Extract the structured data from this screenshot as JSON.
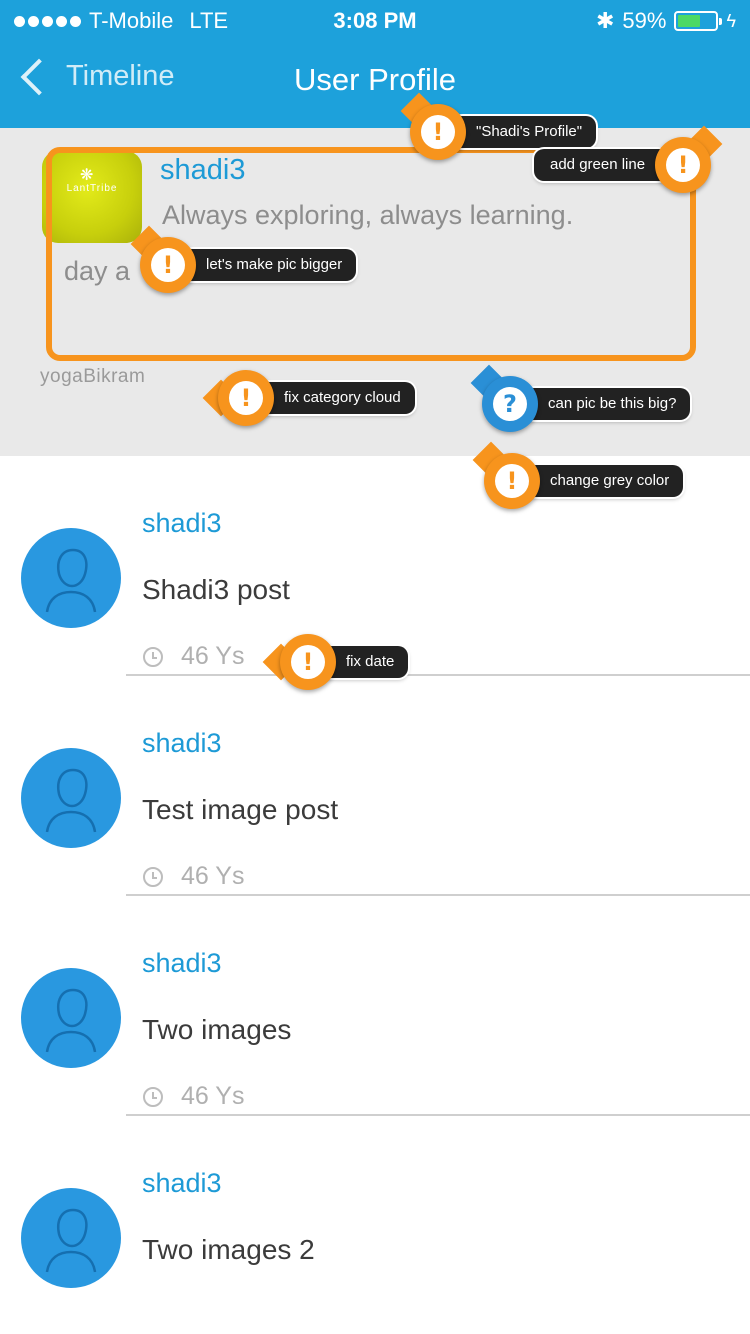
{
  "status_bar": {
    "carrier": "T-Mobile",
    "network": "LTE",
    "time": "3:08 PM",
    "battery_percent": "59%",
    "battery_level": 0.59,
    "colors": {
      "battery_fill": "#4cd964"
    }
  },
  "nav": {
    "back_label": "Timeline",
    "title": "User Profile",
    "colors": {
      "background": "#1da1db"
    }
  },
  "profile": {
    "username": "shadi3",
    "bio": "Always exploring, always learning.",
    "bio_overflow": "day a",
    "category": "yogaBikram",
    "avatar_icon": "lanttribe-logo",
    "avatar_text": "LantTribe",
    "colors": {
      "background": "#e9e9e9",
      "username": "#1d9ad6"
    }
  },
  "posts": [
    {
      "user": "shadi3",
      "text": "Shadi3 post",
      "date": "46 Ys"
    },
    {
      "user": "shadi3",
      "text": "Test image post",
      "date": "46 Ys"
    },
    {
      "user": "shadi3",
      "text": "Two images",
      "date": "46 Ys"
    },
    {
      "user": "shadi3",
      "text": "Two images 2",
      "date": ""
    }
  ],
  "annotations": {
    "shadis_profile": "\"Shadi's Profile\"",
    "add_green_line": "add green line",
    "bigger_pic": "let's make pic bigger",
    "fix_category": "fix category cloud",
    "pic_big": "can pic be this big?",
    "grey_color": "change grey color",
    "fix_date": "fix date",
    "warning_glyph": "!",
    "question_glyph": "?",
    "colors": {
      "warning": "#f7941d",
      "question": "#2a8fd6",
      "pill": "#222222"
    }
  }
}
